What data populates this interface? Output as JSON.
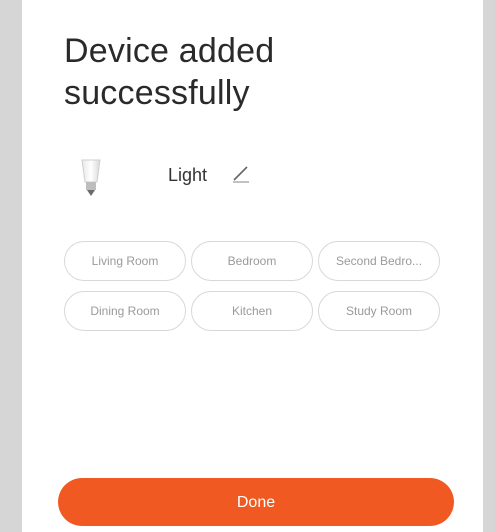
{
  "title": "Device added\nsuccessfully",
  "device": {
    "name": "Light",
    "icon": "light-bulb-icon",
    "edit_icon": "pencil-icon"
  },
  "rooms": [
    "Living Room",
    "Bedroom",
    "Second Bedro...",
    "Dining Room",
    "Kitchen",
    "Study Room"
  ],
  "done_label": "Done",
  "colors": {
    "accent": "#f05a22",
    "room_border": "#d8d8d8",
    "room_text": "#9a9a9a"
  }
}
